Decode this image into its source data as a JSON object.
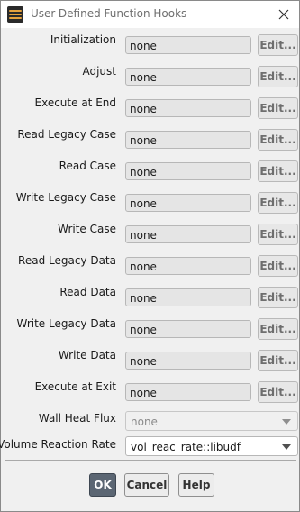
{
  "window": {
    "title": "User-Defined Function Hooks"
  },
  "hooks": [
    {
      "label": "Initialization",
      "value": "none",
      "edit_label": "Edit..."
    },
    {
      "label": "Adjust",
      "value": "none",
      "edit_label": "Edit..."
    },
    {
      "label": "Execute at End",
      "value": "none",
      "edit_label": "Edit..."
    },
    {
      "label": "Read Legacy Case",
      "value": "none",
      "edit_label": "Edit..."
    },
    {
      "label": "Read Case",
      "value": "none",
      "edit_label": "Edit..."
    },
    {
      "label": "Write Legacy Case",
      "value": "none",
      "edit_label": "Edit..."
    },
    {
      "label": "Write Case",
      "value": "none",
      "edit_label": "Edit..."
    },
    {
      "label": "Read Legacy Data",
      "value": "none",
      "edit_label": "Edit..."
    },
    {
      "label": "Read Data",
      "value": "none",
      "edit_label": "Edit..."
    },
    {
      "label": "Write Legacy Data",
      "value": "none",
      "edit_label": "Edit..."
    },
    {
      "label": "Write Data",
      "value": "none",
      "edit_label": "Edit..."
    },
    {
      "label": "Execute at Exit",
      "value": "none",
      "edit_label": "Edit..."
    }
  ],
  "wall_heat_flux": {
    "label": "Wall Heat Flux",
    "value": "none"
  },
  "volume_reaction_rate": {
    "label": "Volume Reaction Rate",
    "value": "vol_reac_rate::libudf"
  },
  "buttons": {
    "ok": "OK",
    "cancel": "Cancel",
    "help": "Help"
  },
  "colors": {
    "ok_button": "#5b6673",
    "field_bg": "#e5e5e5",
    "window_bg": "#f0f0f0"
  }
}
